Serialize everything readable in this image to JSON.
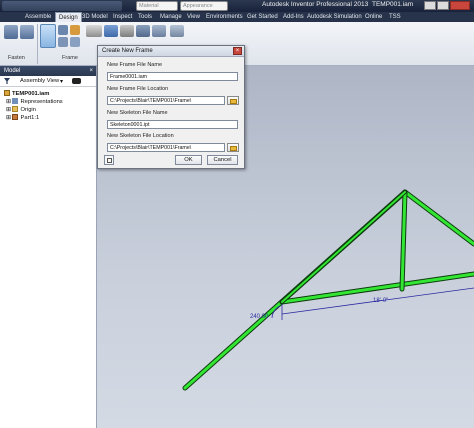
{
  "window": {
    "app_title": "Autodesk Inventor Professional 2013",
    "doc_title": "TEMP001.iam",
    "material": "Material",
    "appearance": "Appearance",
    "help_icon": "help-icon"
  },
  "tabs": [
    "Assemble",
    "Design",
    "3D Model",
    "Inspect",
    "Tools",
    "Manage",
    "View",
    "Environments",
    "Get Started",
    "Add-Ins",
    "Autodesk Simulation",
    "Online",
    "TSS"
  ],
  "ribbon": {
    "panel_fasten": "Fasten",
    "panel_frame": "Frame"
  },
  "browser": {
    "header": "Model",
    "filter": "Assembly View",
    "items": [
      {
        "label": "TEMP001.iam",
        "icon": "assembly-icon"
      },
      {
        "label": "Representations",
        "icon": "representations-icon"
      },
      {
        "label": "Origin",
        "icon": "folder-icon"
      },
      {
        "label": "Part1:1",
        "icon": "part-icon"
      }
    ]
  },
  "dialog": {
    "title": "Create New Frame",
    "frame_file_name_label": "New Frame File Name",
    "frame_file_name": "Frame0001.iam",
    "frame_file_location_label": "New Frame File Location",
    "frame_file_location": "C:\\Projects\\Blair\\TEMP001\\Frame\\",
    "skeleton_file_name_label": "New Skeleton File Name",
    "skeleton_file_name": "Skeleton0001.ipt",
    "skeleton_file_location_label": "New Skeleton File Location",
    "skeleton_file_location": "C:\\Projects\\Blair\\TEMP001\\Frame\\",
    "ok": "OK",
    "cancel": "Cancel"
  },
  "viewport": {
    "dim_angle": "240.00",
    "dim_length": "18'-0\"",
    "colors": {
      "frame": "#33e633",
      "frame_edge": "#0d3d0d",
      "dimension": "#2a2aa0"
    }
  }
}
